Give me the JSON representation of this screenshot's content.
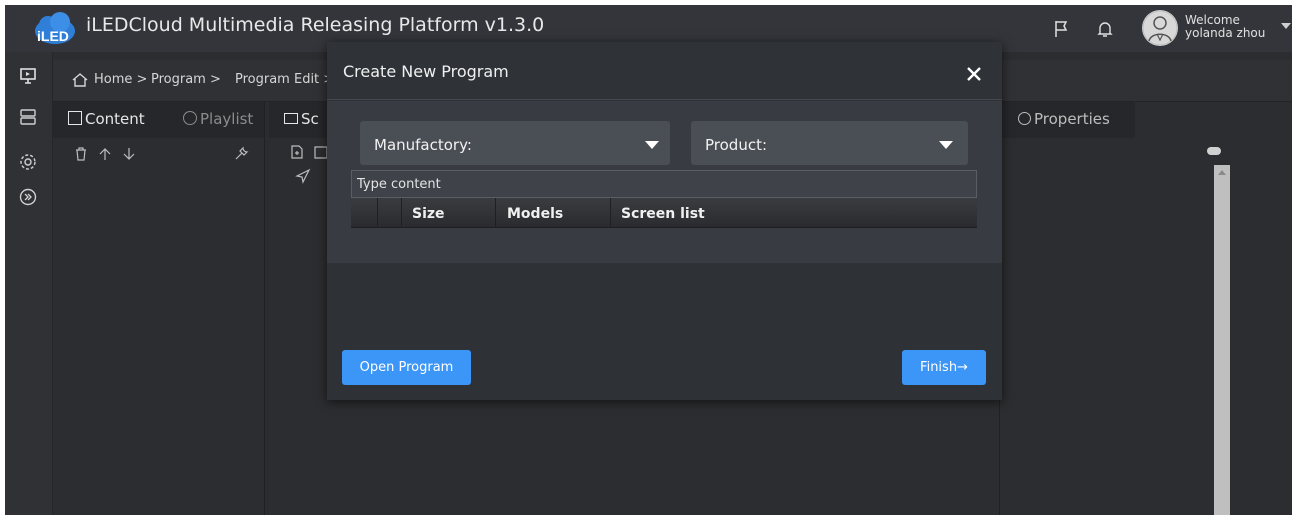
{
  "header": {
    "app_title": "iLEDCloud Multimedia Releasing Platform v1.3.0",
    "logo_text": "iLED",
    "welcome_label": "Welcome",
    "user_name": "yolanda zhou",
    "icons": [
      "flag-icon",
      "bell-icon",
      "avatar",
      "chevron-down-icon"
    ]
  },
  "breadcrumb": {
    "home": "Home >",
    "program": "Program >",
    "program_edit": "Program Edit >"
  },
  "left_panel": {
    "tabs": [
      {
        "label": "Content",
        "icon": "content-icon"
      },
      {
        "label": "Playlist",
        "icon": "playlist-icon"
      }
    ],
    "tools": [
      "trash-icon",
      "arrow-up-icon",
      "arrow-down-icon",
      "wrench-icon"
    ]
  },
  "mid_panel": {
    "tab_label": "Sc",
    "tools": [
      "add-file-icon",
      "edit-icon",
      "send-icon"
    ]
  },
  "right_panel": {
    "tab_label": "Properties"
  },
  "modal": {
    "title": "Create New Program",
    "manufactory_label": "Manufactory:",
    "product_label": "Product:",
    "search_placeholder": "Type content",
    "columns": [
      "",
      "",
      "Size",
      "Models",
      "Screen list"
    ],
    "open_button": "Open Program",
    "finish_button": "Finish→"
  },
  "colors": {
    "accent": "#3c96f7",
    "background": "#2b2d30",
    "modal": "#2e3237",
    "modal_body": "#383c42"
  }
}
